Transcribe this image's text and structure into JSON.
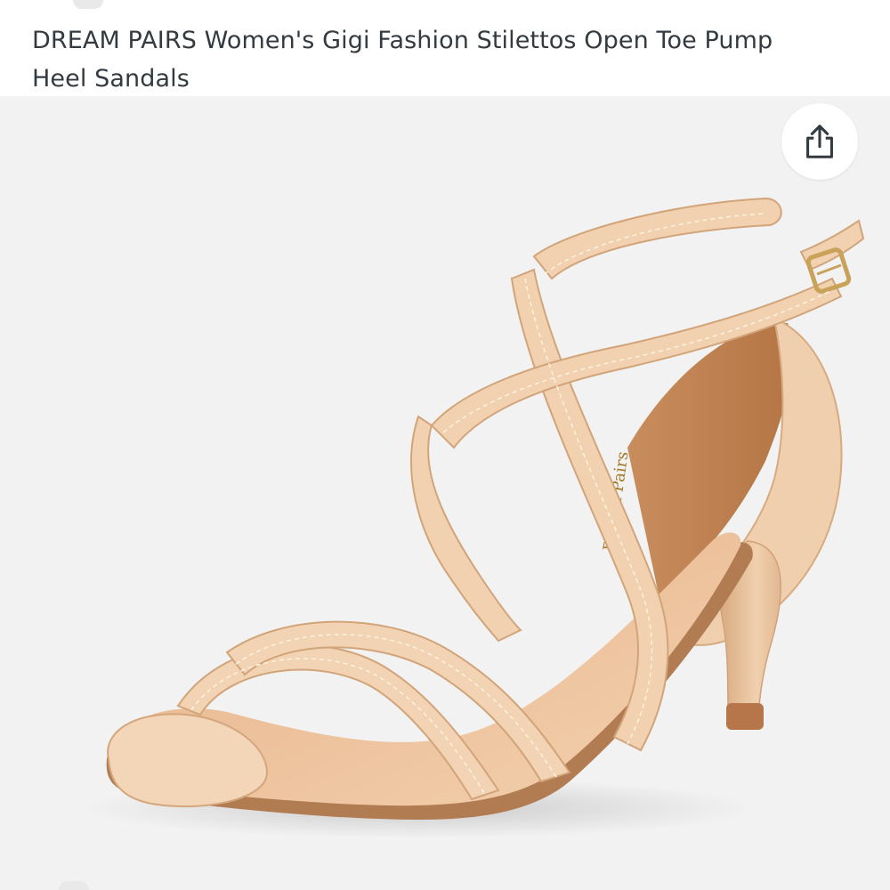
{
  "product": {
    "title": "DREAM PAIRS Women's Gigi Fashion Stilettos Open Toe Pump Heel Sandals",
    "image_alt": "DREAM PAIRS nude strappy stiletto heel sandal",
    "insole_brand": "Dream Pairs"
  },
  "actions": {
    "share_icon": "share-icon"
  },
  "colors": {
    "image_background": "#f2f2f2",
    "strap": "#f1d2b2",
    "strap_shadow": "#d9b08c",
    "sole_edge": "#b8804f",
    "insole": "#e8bf99",
    "heel": "#e9c4a0",
    "text": "#333a40",
    "share_icon": "#333a40"
  }
}
